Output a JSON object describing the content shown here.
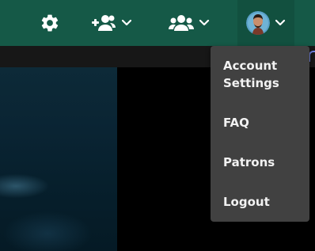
{
  "navbar": {
    "background": "#155947",
    "icons": {
      "settings": "gear-icon",
      "add_friend": "user-plus-icon",
      "friends": "users-icon",
      "dropdown": "chevron-down-icon"
    }
  },
  "account_menu": {
    "items": [
      {
        "label": "Account\nSettings"
      },
      {
        "label": "FAQ"
      },
      {
        "label": "Patrons"
      },
      {
        "label": "Logout"
      }
    ]
  }
}
